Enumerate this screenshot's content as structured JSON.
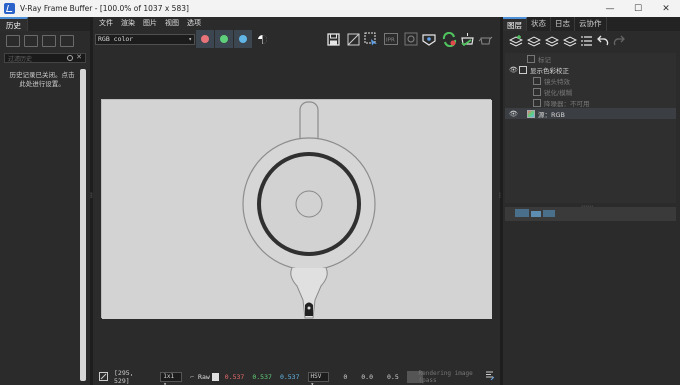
{
  "window": {
    "title": "V-Ray Frame Buffer - [100.0% of 1037 x 583]",
    "controls": [
      "—",
      "☐",
      "✕"
    ]
  },
  "left_panel": {
    "tab": "历史",
    "search_placeholder": "过滤历史",
    "message": "历史记录已关闭。点击此处进行设置。"
  },
  "menu": [
    "文件",
    "渲染",
    "图片",
    "视图",
    "选项"
  ],
  "toolbar": {
    "channel": "RGB color",
    "colors": {
      "red": "#e8747a",
      "green": "#5fd07a",
      "blue": "#62b6e6"
    }
  },
  "status": {
    "coords": "[295, 529]",
    "zoom": "1x1",
    "mode": "Raw",
    "r": "0.537",
    "g": "0.537",
    "b": "0.537",
    "space": "HSV",
    "h": "0",
    "s": "0.0",
    "v": "0.5",
    "message": "Rendering image (pass"
  },
  "right_panel": {
    "tabs": [
      "图层",
      "状态",
      "日志",
      "云协作"
    ],
    "layers": [
      {
        "label": "标记",
        "dim": true,
        "eye": false
      },
      {
        "label": "显示色彩校正",
        "dim": false,
        "eye": true
      },
      {
        "label": "镜头特效",
        "dim": true,
        "eye": false
      },
      {
        "label": "锐化/模糊",
        "dim": true,
        "eye": false
      },
      {
        "label": "降噪器：不可用",
        "dim": true,
        "eye": false
      },
      {
        "label": "源：RGB",
        "dim": false,
        "eye": true
      }
    ]
  }
}
